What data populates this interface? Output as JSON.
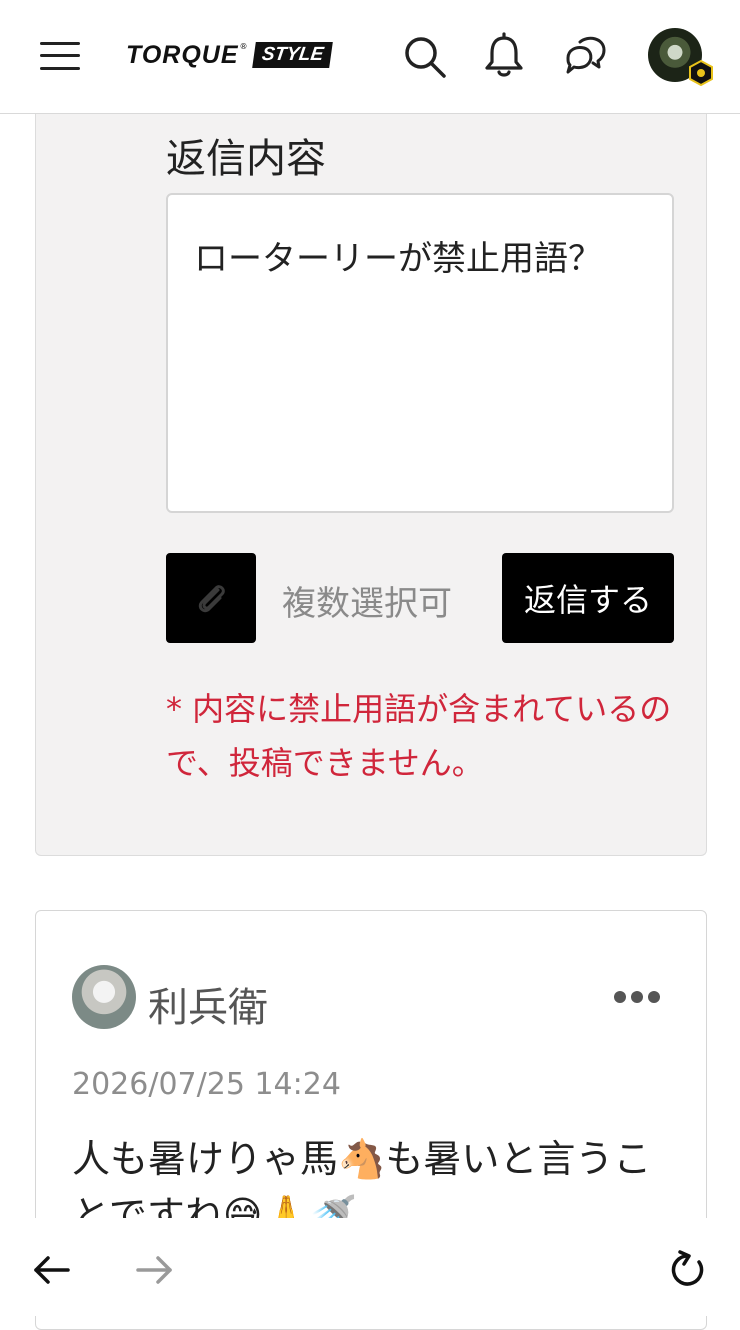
{
  "header": {
    "logo_main": "TORQUE",
    "logo_reg": "®",
    "logo_sub": "STYLE"
  },
  "reply_panel": {
    "title": "返信内容",
    "content": "ローターリーが禁止用語？",
    "multi_select_label": "複数選択可",
    "submit_label": "返信する",
    "error_message": "* 内容に禁止用語が含まれているので、投稿できません。"
  },
  "comment": {
    "author": "利兵衛",
    "date": "2026/07/25 14:24",
    "body": "人も暑けりゃ馬🐴も暑いと言うことですね😅🙏🚿"
  }
}
